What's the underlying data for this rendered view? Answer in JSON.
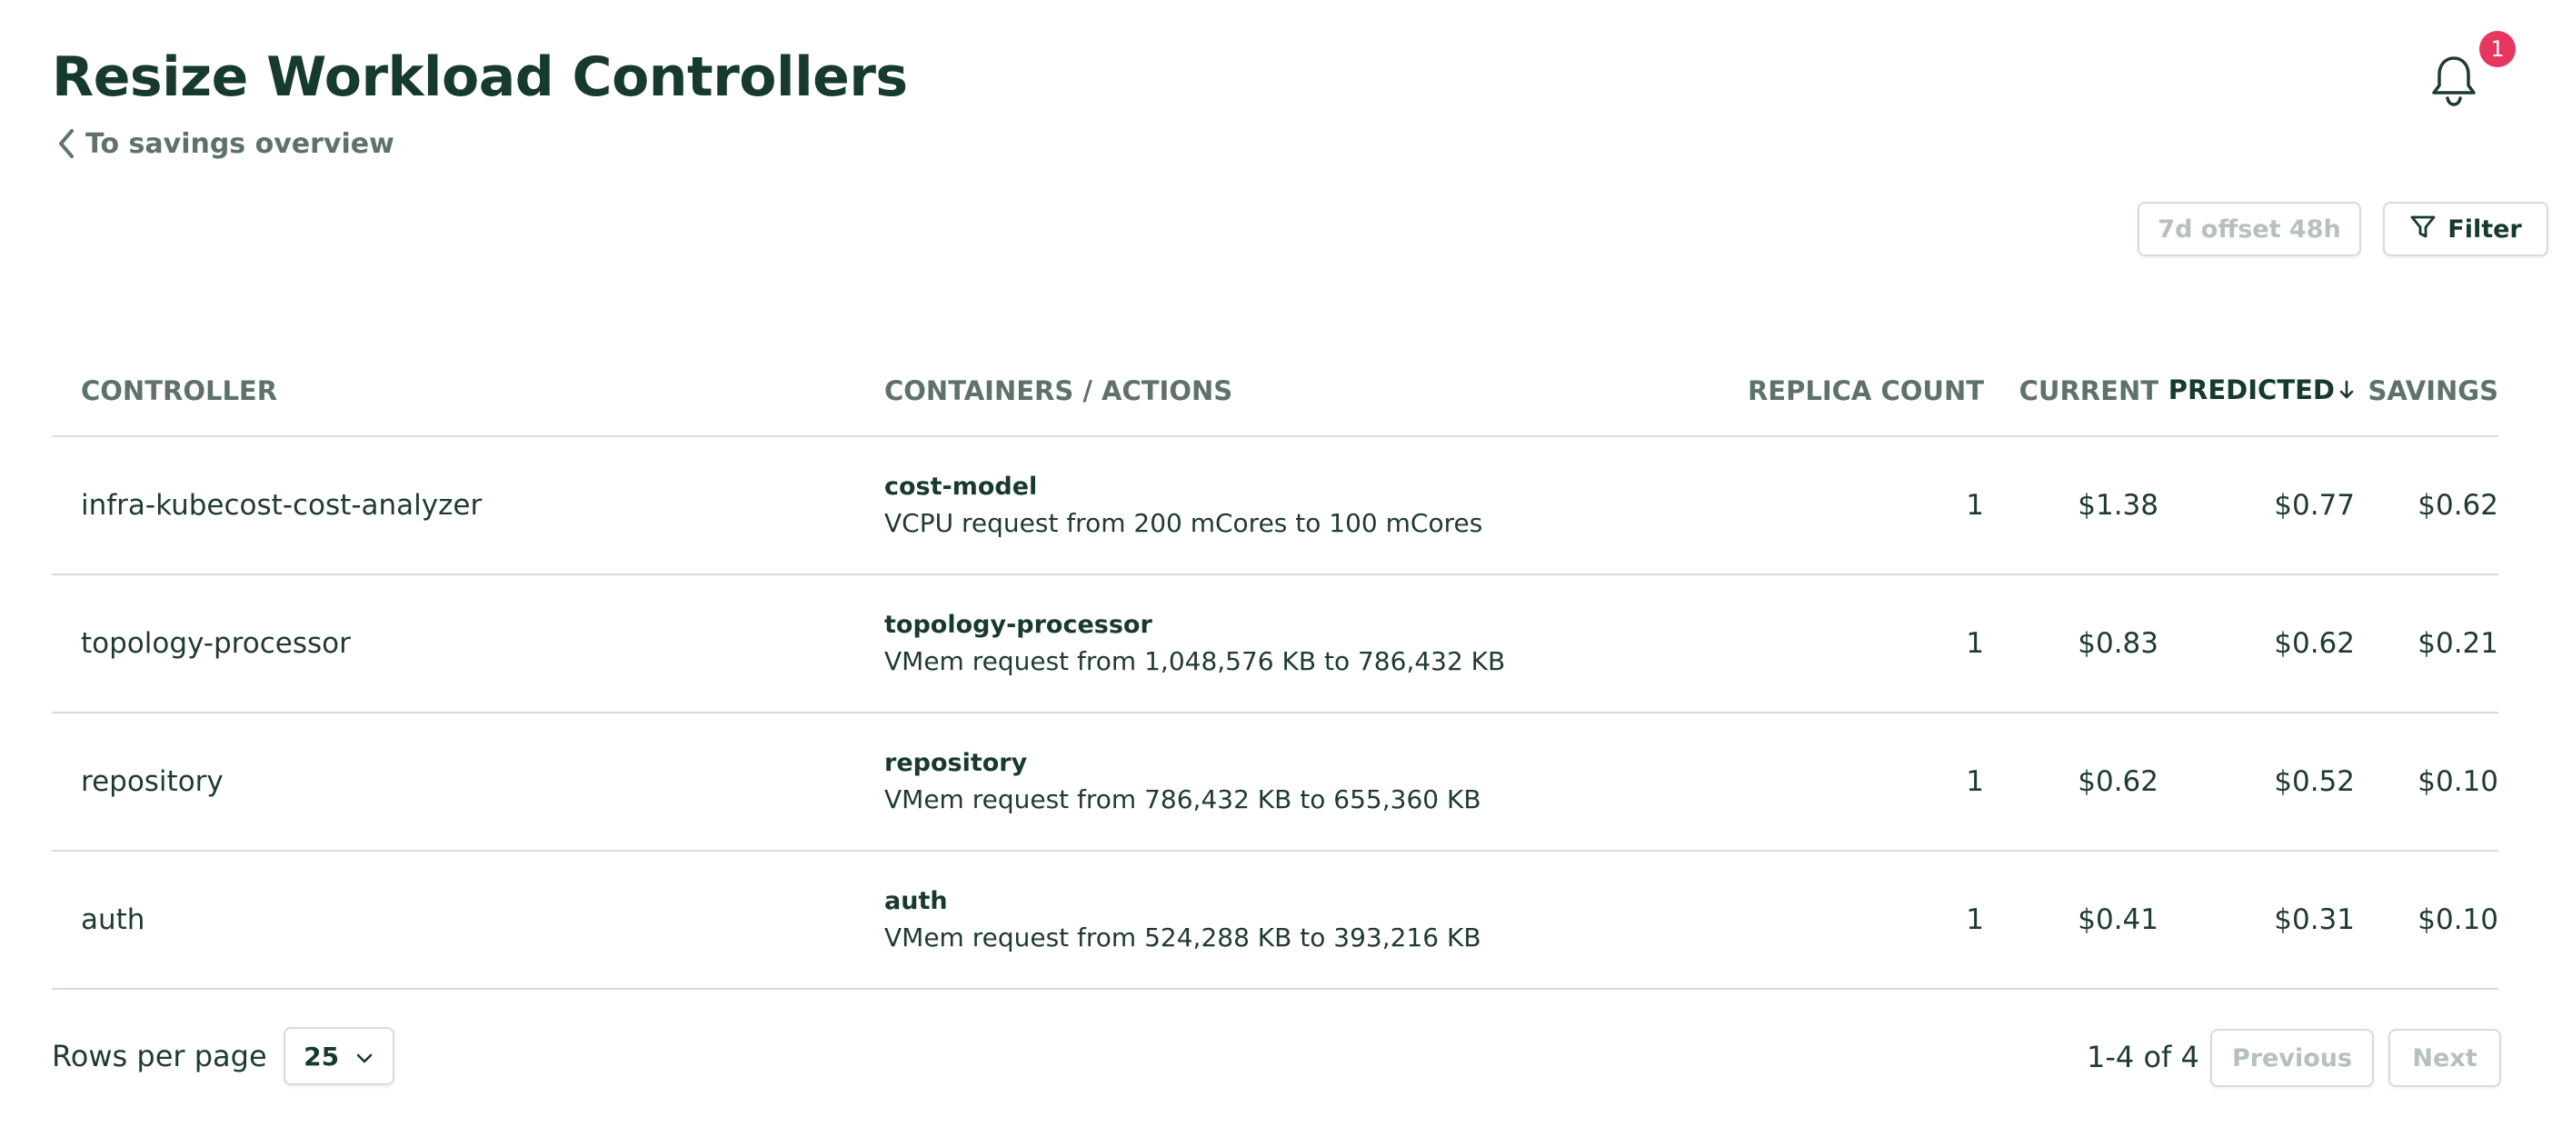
{
  "header": {
    "title": "Resize Workload Controllers",
    "back_link": "To savings overview",
    "notifications_count": "1"
  },
  "toolbar": {
    "window_label": "7d offset 48h",
    "filter_label": "Filter"
  },
  "table": {
    "columns": {
      "controller": "CONTROLLER",
      "containers": "CONTAINERS / ACTIONS",
      "replica": "REPLICA COUNT",
      "current": "CURRENT",
      "predicted": "PREDICTED",
      "savings": "SAVINGS"
    },
    "sort": {
      "column": "predicted",
      "direction": "descending"
    },
    "rows": [
      {
        "controller": "infra-kubecost-cost-analyzer",
        "container": "cost-model",
        "action": "VCPU request from 200 mCores to 100 mCores",
        "replica": "1",
        "current": "$1.38",
        "predicted": "$0.77",
        "savings": "$0.62"
      },
      {
        "controller": "topology-processor",
        "container": "topology-processor",
        "action": "VMem request from 1,048,576 KB to 786,432 KB",
        "replica": "1",
        "current": "$0.83",
        "predicted": "$0.62",
        "savings": "$0.21"
      },
      {
        "controller": "repository",
        "container": "repository",
        "action": "VMem request from 786,432 KB to 655,360 KB",
        "replica": "1",
        "current": "$0.62",
        "predicted": "$0.52",
        "savings": "$0.10"
      },
      {
        "controller": "auth",
        "container": "auth",
        "action": "VMem request from 524,288 KB to 393,216 KB",
        "replica": "1",
        "current": "$0.41",
        "predicted": "$0.31",
        "savings": "$0.10"
      }
    ]
  },
  "pagination": {
    "rows_per_page_label": "Rows per page",
    "rows_per_page_value": "25",
    "range_text": "1-4 of 4",
    "previous_label": "Previous",
    "next_label": "Next"
  },
  "colors": {
    "title": "#173a2e",
    "muted": "#5e716b",
    "border": "#d6dcd9",
    "badge": "#e8375f",
    "disabled_text": "#b6c0bc"
  },
  "icons": [
    "chevron-left-icon",
    "bell-icon",
    "filter-icon",
    "sort-arrow-down-icon",
    "chevron-down-icon"
  ]
}
